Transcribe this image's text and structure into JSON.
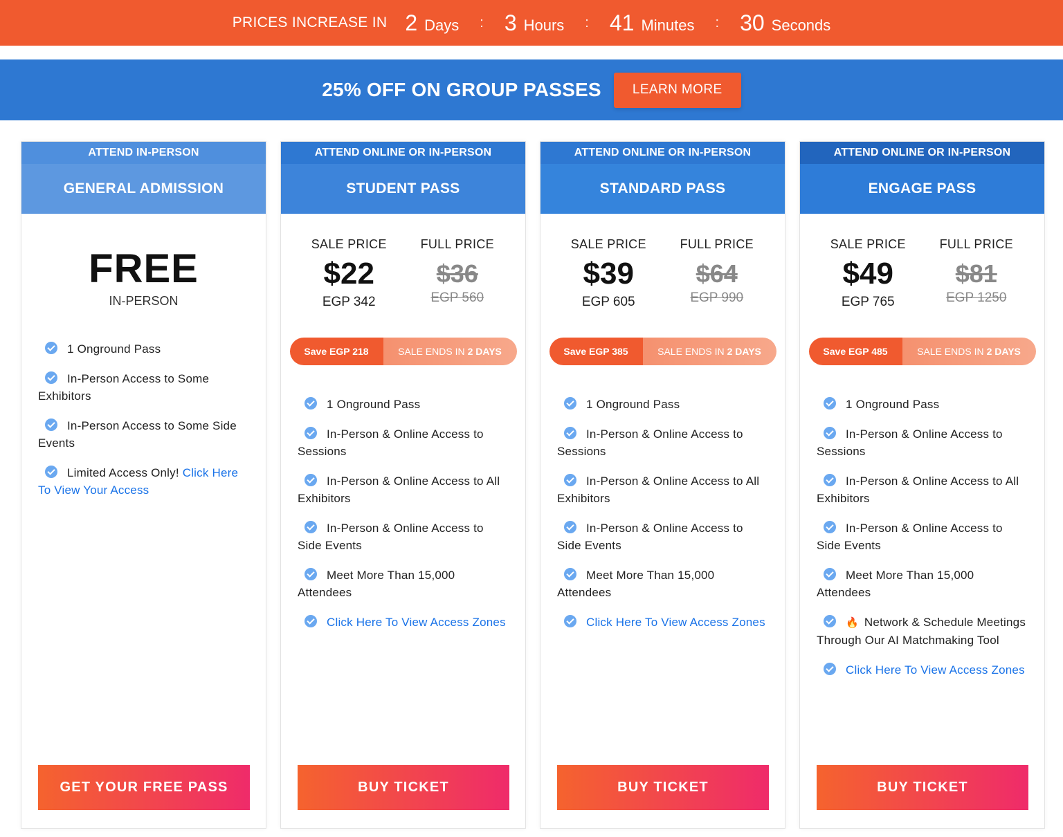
{
  "countdown": {
    "lead": "PRICES INCREASE IN",
    "days": "2",
    "days_label": "Days",
    "hours": "3",
    "hours_label": "Hours",
    "minutes": "41",
    "minutes_label": "Minutes",
    "seconds": "30",
    "seconds_label": "Seconds",
    "separator": ":"
  },
  "promo": {
    "text": "25% OFF ON GROUP PASSES",
    "button": "LEARN MORE"
  },
  "colors": {
    "orange": "#f05a2f",
    "blue": "#2e78d2",
    "check": "#6aa8f0",
    "link": "#1a73e8"
  },
  "plans": [
    {
      "top": "ATTEND IN-PERSON",
      "title": "GENERAL ADMISSION",
      "price": "FREE",
      "price_sub": "IN-PERSON",
      "features": [
        {
          "text": "1 Onground Pass"
        },
        {
          "text": "In-Person Access to Some Exhibitors"
        },
        {
          "text": "In-Person Access to Some Side Events"
        },
        {
          "text": "Limited Access Only! ",
          "link": "Click Here To View Your Access"
        }
      ],
      "cta": "GET YOUR FREE PASS"
    },
    {
      "top": "ATTEND ONLINE OR IN-PERSON",
      "title": "STUDENT PASS",
      "sale_label": "SALE PRICE",
      "full_label": "FULL PRICE",
      "sale_price": "$22",
      "sale_egp": "EGP 342",
      "full_price": "$36",
      "full_egp": "EGP 560",
      "save": "Save EGP 218",
      "sale_ends": "SALE ENDS IN",
      "sale_ends_bold": "2 DAYS",
      "features": [
        {
          "text": "1 Onground Pass"
        },
        {
          "text": "In-Person & Online Access to Sessions"
        },
        {
          "text": "In-Person & Online Access to All Exhibitors"
        },
        {
          "text": "In-Person & Online Access to Side Events"
        },
        {
          "text": "Meet More Than 15,000 Attendees"
        },
        {
          "link": "Click Here To View Access Zones"
        }
      ],
      "cta": "BUY TICKET"
    },
    {
      "top": "ATTEND ONLINE OR IN-PERSON",
      "title": "STANDARD PASS",
      "sale_label": "SALE PRICE",
      "full_label": "FULL PRICE",
      "sale_price": "$39",
      "sale_egp": "EGP 605",
      "full_price": "$64",
      "full_egp": "EGP 990",
      "save": "Save EGP 385",
      "sale_ends": "SALE ENDS IN",
      "sale_ends_bold": "2 DAYS",
      "features": [
        {
          "text": "1 Onground Pass"
        },
        {
          "text": "In-Person & Online Access to Sessions"
        },
        {
          "text": "In-Person & Online Access to All Exhibitors"
        },
        {
          "text": "In-Person & Online Access to Side Events"
        },
        {
          "text": "Meet More Than 15,000 Attendees"
        },
        {
          "link": "Click Here To View Access Zones"
        }
      ],
      "cta": "BUY TICKET"
    },
    {
      "top": "ATTEND ONLINE OR IN-PERSON",
      "title": "ENGAGE PASS",
      "sale_label": "SALE PRICE",
      "full_label": "FULL PRICE",
      "sale_price": "$49",
      "sale_egp": "EGP 765",
      "full_price": "$81",
      "full_egp": "EGP 1250",
      "save": "Save EGP 485",
      "sale_ends": "SALE ENDS IN",
      "sale_ends_bold": "2 DAYS",
      "features": [
        {
          "text": "1 Onground Pass"
        },
        {
          "text": "In-Person & Online Access to Sessions"
        },
        {
          "text": "In-Person & Online Access to All Exhibitors"
        },
        {
          "text": "In-Person & Online Access to Side Events"
        },
        {
          "text": "Meet More Than 15,000 Attendees"
        },
        {
          "icon": "fire-icon",
          "text": "Network & Schedule Meetings Through Our AI Matchmaking Tool"
        },
        {
          "link": "Click Here To View Access Zones"
        }
      ],
      "cta": "BUY TICKET"
    }
  ]
}
